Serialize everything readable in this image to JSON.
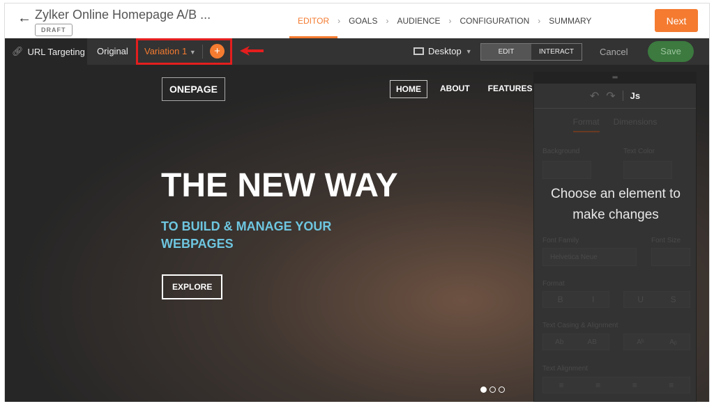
{
  "header": {
    "title": "Zylker Online Homepage A/B ...",
    "status": "DRAFT",
    "steps": [
      "EDITOR",
      "GOALS",
      "AUDIENCE",
      "CONFIGURATION",
      "SUMMARY"
    ],
    "active_step": "EDITOR",
    "next_label": "Next"
  },
  "toolbar": {
    "url_targeting": "URL Targeting",
    "original": "Original",
    "variation": "Variation 1",
    "add": "+",
    "device": "Desktop",
    "modes": [
      "EDIT",
      "INTERACT"
    ],
    "active_mode": "INTERACT",
    "cancel": "Cancel",
    "save": "Save"
  },
  "site": {
    "logo": "ONEPAGE",
    "nav": [
      "HOME",
      "ABOUT",
      "FEATURES"
    ],
    "headline": "THE NEW WAY",
    "subheadline": "TO BUILD & MANAGE YOUR WEBPAGES",
    "cta": "EXPLORE",
    "slides": 3,
    "active_slide": 1
  },
  "panel": {
    "js": "Js",
    "tabs": [
      "Format",
      "Dimensions"
    ],
    "background": "Background",
    "text_color": "Text Color",
    "font_family": "Font Family",
    "font_family_value": "Helvetica Neue",
    "font_size": "Font Size",
    "format": "Format",
    "bold": "B",
    "italic": "I",
    "underline": "U",
    "strike": "S",
    "text_casing": "Text Casing & Alignment",
    "casing": [
      "Ab",
      "AB",
      "Aᵇ",
      "Aᵦ"
    ],
    "text_alignment": "Text Alignment",
    "message": "Choose an element to make changes"
  },
  "colors": {
    "accent": "#f47b30",
    "save": "#3c7a3f",
    "highlight": "#e41e1e"
  }
}
